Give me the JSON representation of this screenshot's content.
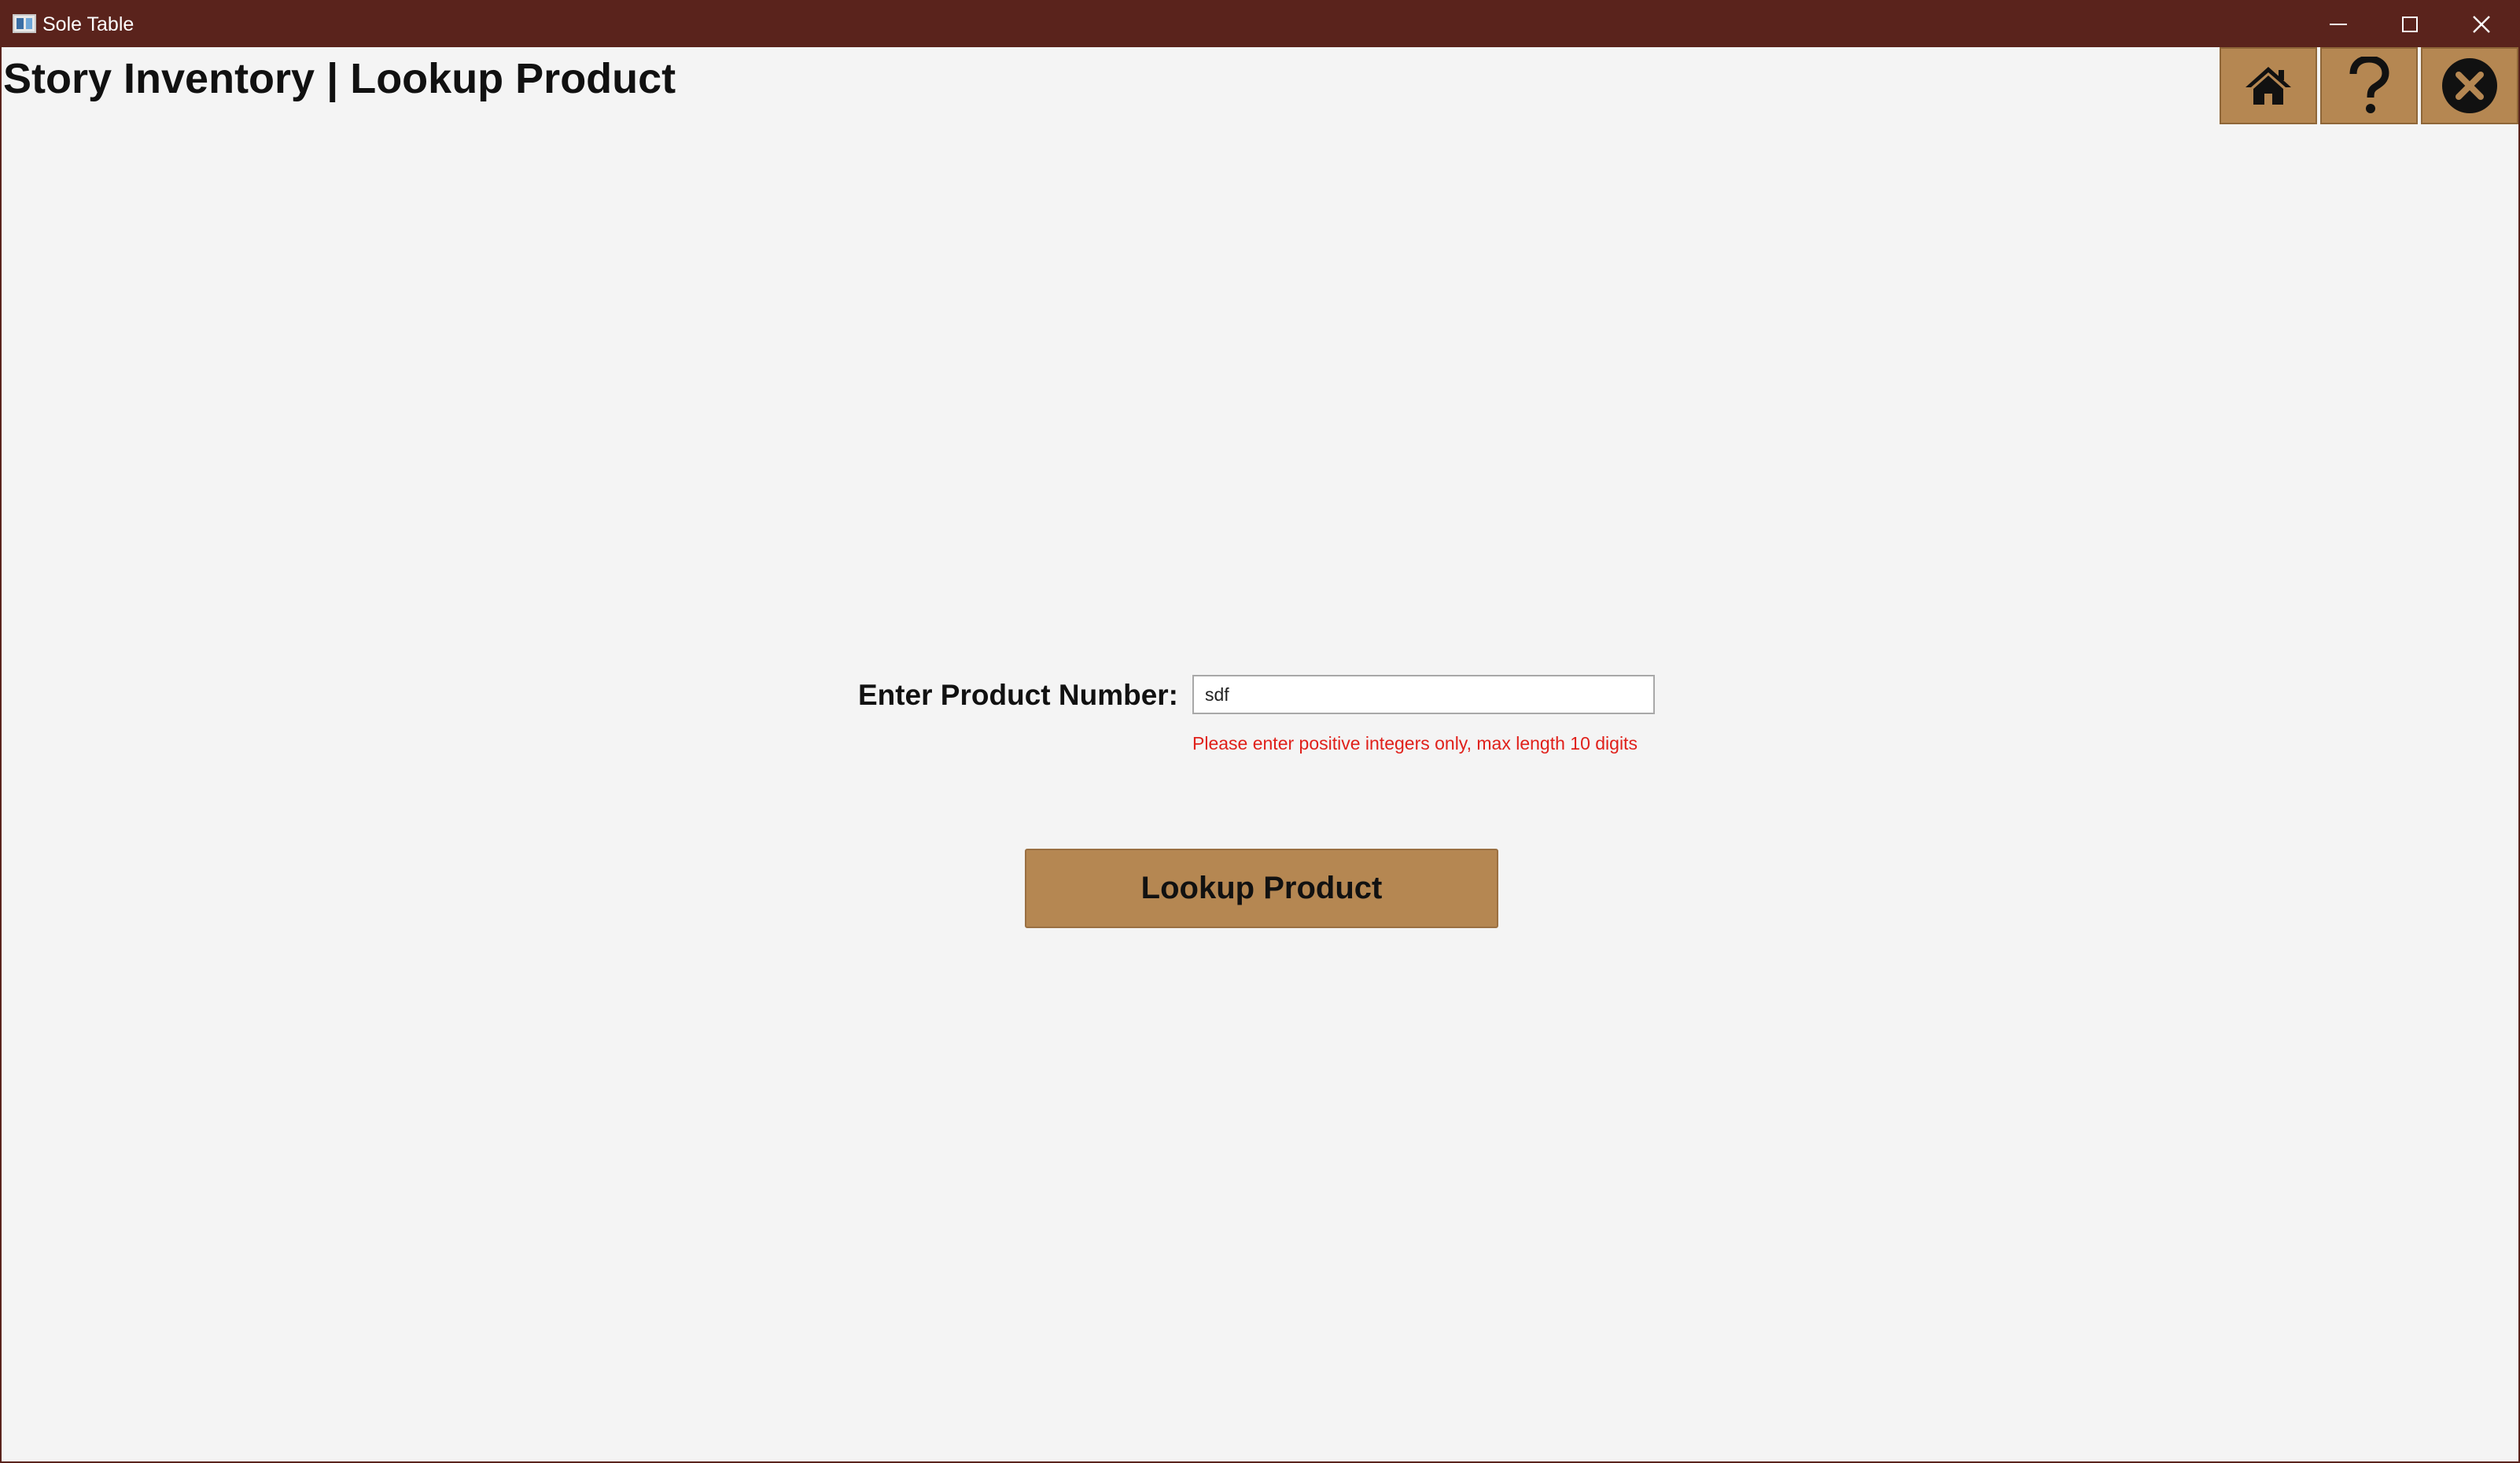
{
  "window": {
    "title": "Sole Table",
    "icon": "app-window-icon",
    "controls": [
      "minimize-icon",
      "maximize-icon",
      "close-icon"
    ]
  },
  "header": {
    "title": "Story Inventory | Lookup Product",
    "actions": [
      {
        "name": "home",
        "icon": "home-icon"
      },
      {
        "name": "help",
        "icon": "question-mark-icon"
      },
      {
        "name": "exit",
        "icon": "close-circle-icon"
      }
    ]
  },
  "form": {
    "label": "Enter Product Number:",
    "input_value": "sdf",
    "error": "Please enter positive integers only, max length 10 digits",
    "submit_label": "Lookup Product"
  },
  "colors": {
    "titlebar": "#5a231c",
    "background": "#f4f4f4",
    "button": "#b58752",
    "error": "#e0201a"
  }
}
